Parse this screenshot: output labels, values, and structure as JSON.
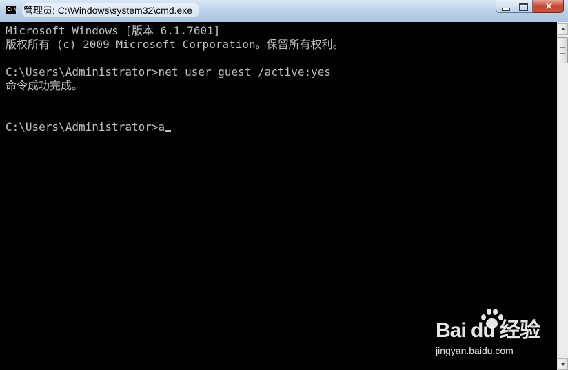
{
  "window": {
    "title": "管理员: C:\\Windows\\system32\\cmd.exe",
    "app_icon_text": "C:\\",
    "controls": {
      "minimize": "minimize",
      "maximize": "maximize",
      "close": "✕"
    }
  },
  "console": {
    "lines": [
      "Microsoft Windows [版本 6.1.7601]",
      "版权所有 (c) 2009 Microsoft Corporation。保留所有权利。",
      "",
      "C:\\Users\\Administrator>net user guest /active:yes",
      "命令成功完成。",
      "",
      "",
      "C:\\Users\\Administrator>a"
    ],
    "colors": {
      "background": "#000000",
      "text": "#c0c0c0"
    }
  },
  "watermark": {
    "logo_text": "Bai du 经验",
    "url": "jingyan.baidu.com"
  }
}
